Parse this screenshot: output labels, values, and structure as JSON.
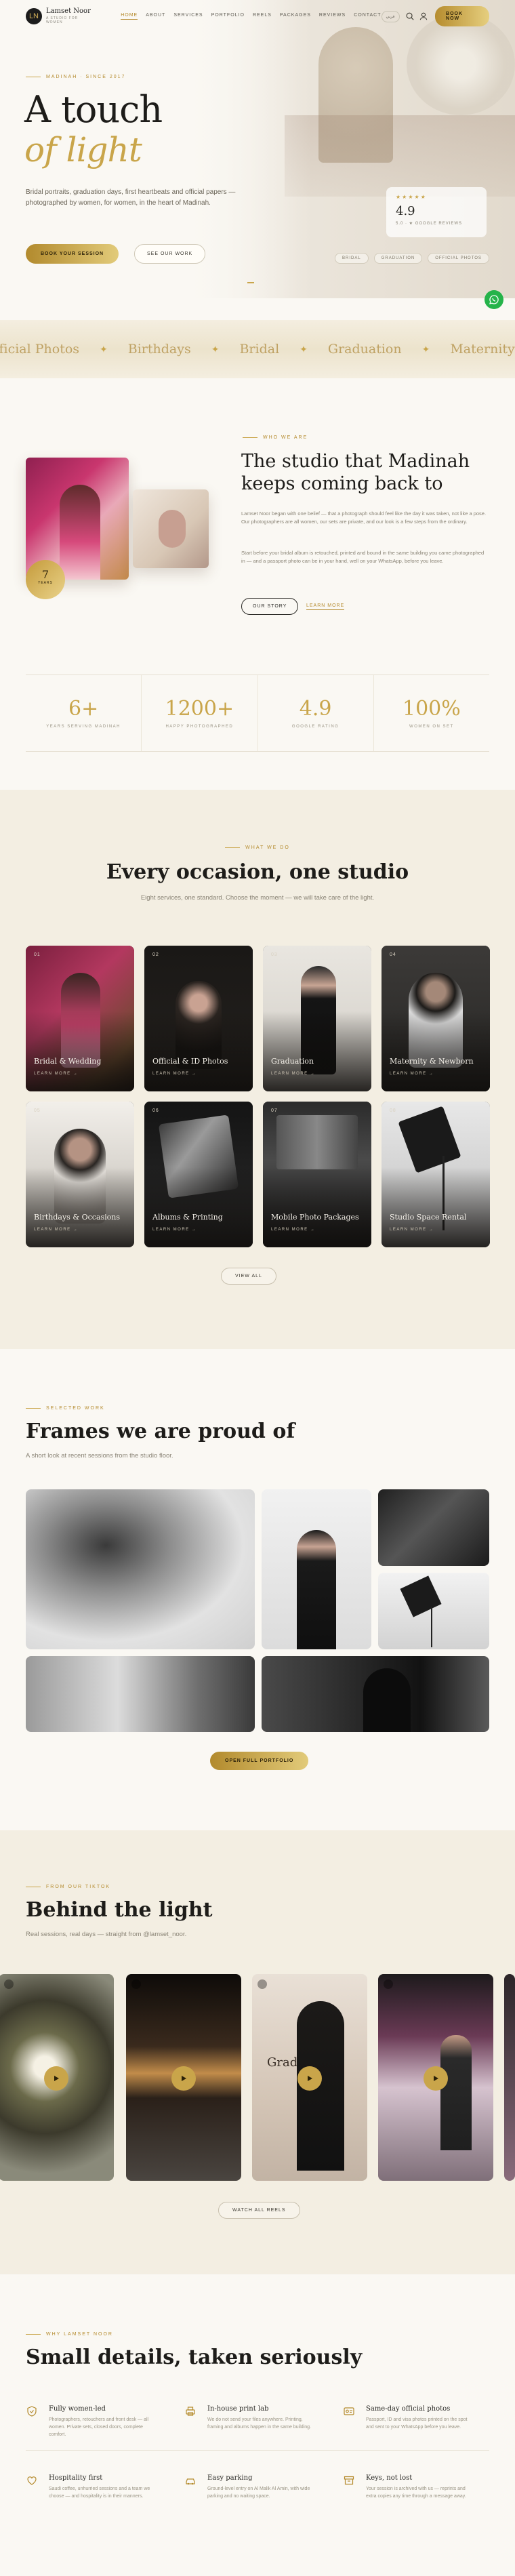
{
  "brand": {
    "name": "Lamset Noor",
    "tagline": "A STUDIO FOR WOMEN",
    "monogram": "LN"
  },
  "nav": {
    "items": [
      "HOME",
      "ABOUT",
      "SERVICES",
      "PORTFOLIO",
      "REELS",
      "PACKAGES",
      "REVIEWS",
      "CONTACT"
    ],
    "lang": "عربي",
    "book": "BOOK NOW"
  },
  "hero": {
    "eyebrow": "MADINAH · SINCE 2017",
    "title_line1": "A touch",
    "title_line2": "of light",
    "subtitle": "Bridal portraits, graduation days, first heartbeats and official papers — photographed by women, for women, in the heart of Madinah.",
    "btn_primary": "BOOK YOUR SESSION",
    "btn_secondary": "SEE OUR WORK",
    "rating": {
      "stars": "★★★★★",
      "value": "4.9",
      "label": "5.0 · ★ GOOGLE REVIEWS"
    },
    "chips": [
      "BRIDAL",
      "GRADUATION",
      "OFFICIAL PHOTOS"
    ]
  },
  "marquee": [
    "fficial Photos",
    "Birthdays",
    "Bridal",
    "Graduation",
    "Maternity"
  ],
  "about": {
    "eyebrow": "WHO WE ARE",
    "title": "The studio that Madinah keeps coming back to",
    "p1": "Lamset Noor began with one belief — that a photograph should feel like the day it was taken, not like a pose. Our photographers are all women, our sets are private, and our look is a few steps from the ordinary.",
    "p2": "Start before your bridal album is retouched, printed and bound in the same building you came photographed in — and a passport photo can be in your hand, well on your WhatsApp, before you leave.",
    "btn_story": "OUR STORY",
    "btn_learn": "LEARN MORE",
    "years_value": "7",
    "years_label": "YEARS"
  },
  "stats": [
    {
      "value": "6+",
      "label": "YEARS SERVING MADINAH"
    },
    {
      "value": "1200+",
      "label": "HAPPY PHOTOGRAPHED"
    },
    {
      "value": "4.9",
      "label": "GOOGLE RATING"
    },
    {
      "value": "100%",
      "label": "WOMEN ON SET"
    }
  ],
  "services": {
    "eyebrow": "WHAT WE DO",
    "title": "Every occasion, one studio",
    "subtitle": "Eight services, one standard. Choose the moment — we will take care of the light.",
    "cards": [
      {
        "num": "01",
        "title": "Bridal & Wedding",
        "cta": "LEARN MORE"
      },
      {
        "num": "02",
        "title": "Official & ID Photos",
        "cta": "LEARN MORE"
      },
      {
        "num": "03",
        "title": "Graduation",
        "cta": "LEARN MORE"
      },
      {
        "num": "04",
        "title": "Maternity & Newborn",
        "cta": "LEARN MORE"
      },
      {
        "num": "05",
        "title": "Birthdays & Occasions",
        "cta": "LEARN MORE"
      },
      {
        "num": "06",
        "title": "Albums & Printing",
        "cta": "LEARN MORE"
      },
      {
        "num": "07",
        "title": "Mobile Photo Packages",
        "cta": "LEARN MORE"
      },
      {
        "num": "08",
        "title": "Studio Space Rental",
        "cta": "LEARN MORE"
      }
    ],
    "view_all": "VIEW ALL"
  },
  "portfolio": {
    "eyebrow": "SELECTED WORK",
    "title": "Frames we are proud of",
    "subtitle": "A short look at recent sessions from the studio floor.",
    "btn": "OPEN FULL PORTFOLIO"
  },
  "reels": {
    "eyebrow": "FROM OUR TIKTOK",
    "title": "Behind the light",
    "subtitle": "Real sessions, real days — straight from @lamset_noor.",
    "btn": "WATCH ALL REELS",
    "overlay_text": "Grad"
  },
  "why": {
    "eyebrow": "WHY LAMSET NOOR",
    "title": "Small details, taken seriously",
    "features": [
      {
        "title": "Fully women-led",
        "desc": "Photographers, retouchers and front desk — all women. Private sets, closed doors, complete comfort."
      },
      {
        "title": "In-house print lab",
        "desc": "We do not send your files anywhere. Printing, framing and albums happen in the same building."
      },
      {
        "title": "Same-day official photos",
        "desc": "Passport, ID and visa photos printed on the spot and sent to your WhatsApp before you leave."
      },
      {
        "title": "Hospitality first",
        "desc": "Saudi coffee, unhurried sessions and a team we choose — and hospitality is in their manners."
      },
      {
        "title": "Easy parking",
        "desc": "Ground-level entry on Al Malik Al Amin, with wide parking and no waiting space."
      },
      {
        "title": "Keys, not lost",
        "desc": "Your session is archived with us — reprints and extra copies any time through a message away."
      }
    ]
  },
  "colors": {
    "gold": "#c9a54a",
    "cream": "#faf8f3",
    "sand": "#f3eee2",
    "ink": "#1d1c19",
    "whatsapp": "#25b34a"
  }
}
